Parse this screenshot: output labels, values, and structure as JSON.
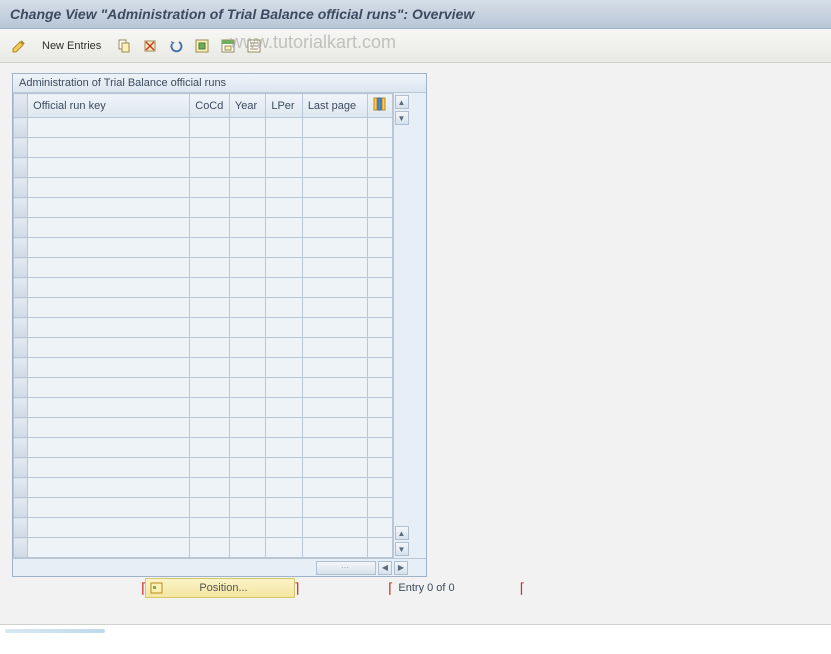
{
  "title": "Change View \"Administration of Trial Balance official runs\": Overview",
  "toolbar": {
    "new_entries": "New Entries"
  },
  "panel": {
    "title": "Administration of Trial Balance official runs",
    "columns": {
      "key": "Official run key",
      "cocd": "CoCd",
      "year": "Year",
      "lper": "LPer",
      "last": "Last page"
    },
    "rows": 22
  },
  "footer": {
    "position": "Position...",
    "entry": "Entry 0 of 0"
  },
  "watermark": "www.tutorialkart.com"
}
